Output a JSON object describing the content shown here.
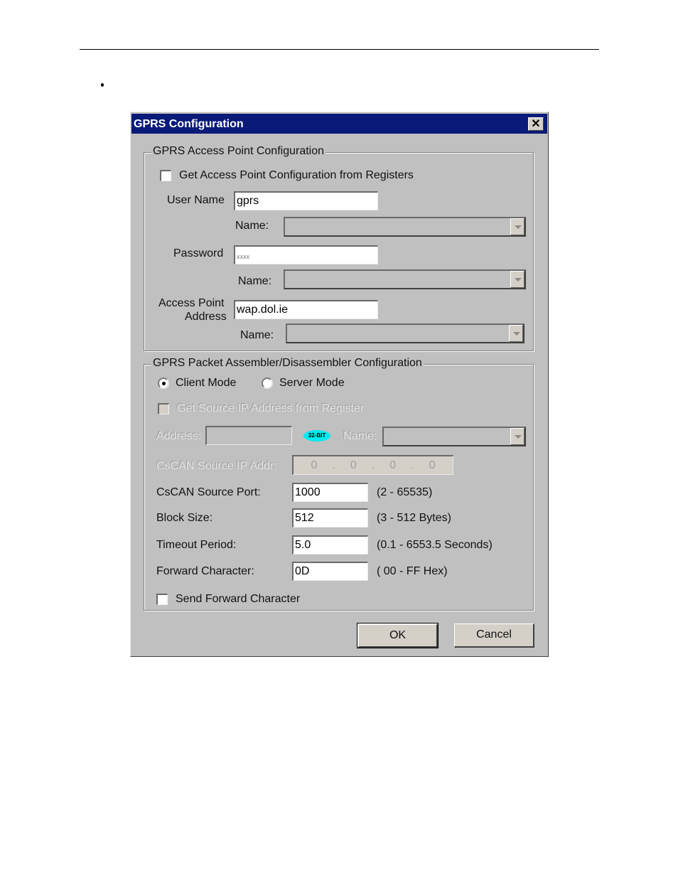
{
  "page": {
    "bullet": "•"
  },
  "dialog": {
    "title": "GPRS Configuration",
    "close_glyph": "✕",
    "access_point": {
      "group_label": "GPRS Access Point Configuration",
      "get_from_registers": {
        "label": "Get Access Point Configuration from Registers",
        "checked": false
      },
      "user_name": {
        "label": "User Name",
        "value": "gprs",
        "name_label": "Name:",
        "name_value": ""
      },
      "password": {
        "label": "Password",
        "value": "xxxx",
        "name_label": "Name:",
        "name_value": ""
      },
      "access_point_address": {
        "label_line1": "Access Point",
        "label_line2": "Address",
        "value": "wap.dol.ie",
        "name_label": "Name:",
        "name_value": ""
      }
    },
    "pad": {
      "group_label": "GPRS Packet Assembler/Disassembler Configuration",
      "modes": [
        {
          "label": "Client Mode",
          "selected": true
        },
        {
          "label": "Server Mode",
          "selected": false
        }
      ],
      "get_source_ip": {
        "label": "Get Source IP Address from Register",
        "checked": false,
        "disabled": true
      },
      "address": {
        "label": "Address:",
        "value": "",
        "badge": "32-BIT",
        "name_label": "Name:",
        "name_value": ""
      },
      "source_ip": {
        "label": "CsCAN Source IP Addr:",
        "octets": [
          "0",
          "0",
          "0",
          "0"
        ],
        "separator": "."
      },
      "source_port": {
        "label": "CsCAN Source Port:",
        "value": "1000",
        "range": "(2 - 65535)"
      },
      "block_size": {
        "label": "Block Size:",
        "value": "512",
        "range": "(3 - 512 Bytes)"
      },
      "timeout": {
        "label": "Timeout Period:",
        "value": "5.0",
        "range": "(0.1 - 6553.5 Seconds)"
      },
      "forward_char": {
        "label": "Forward Character:",
        "value": "0D",
        "range": "( 00 - FF Hex)"
      },
      "send_forward": {
        "label": "Send Forward Character",
        "checked": false
      }
    },
    "buttons": {
      "ok": "OK",
      "cancel": "Cancel"
    }
  }
}
